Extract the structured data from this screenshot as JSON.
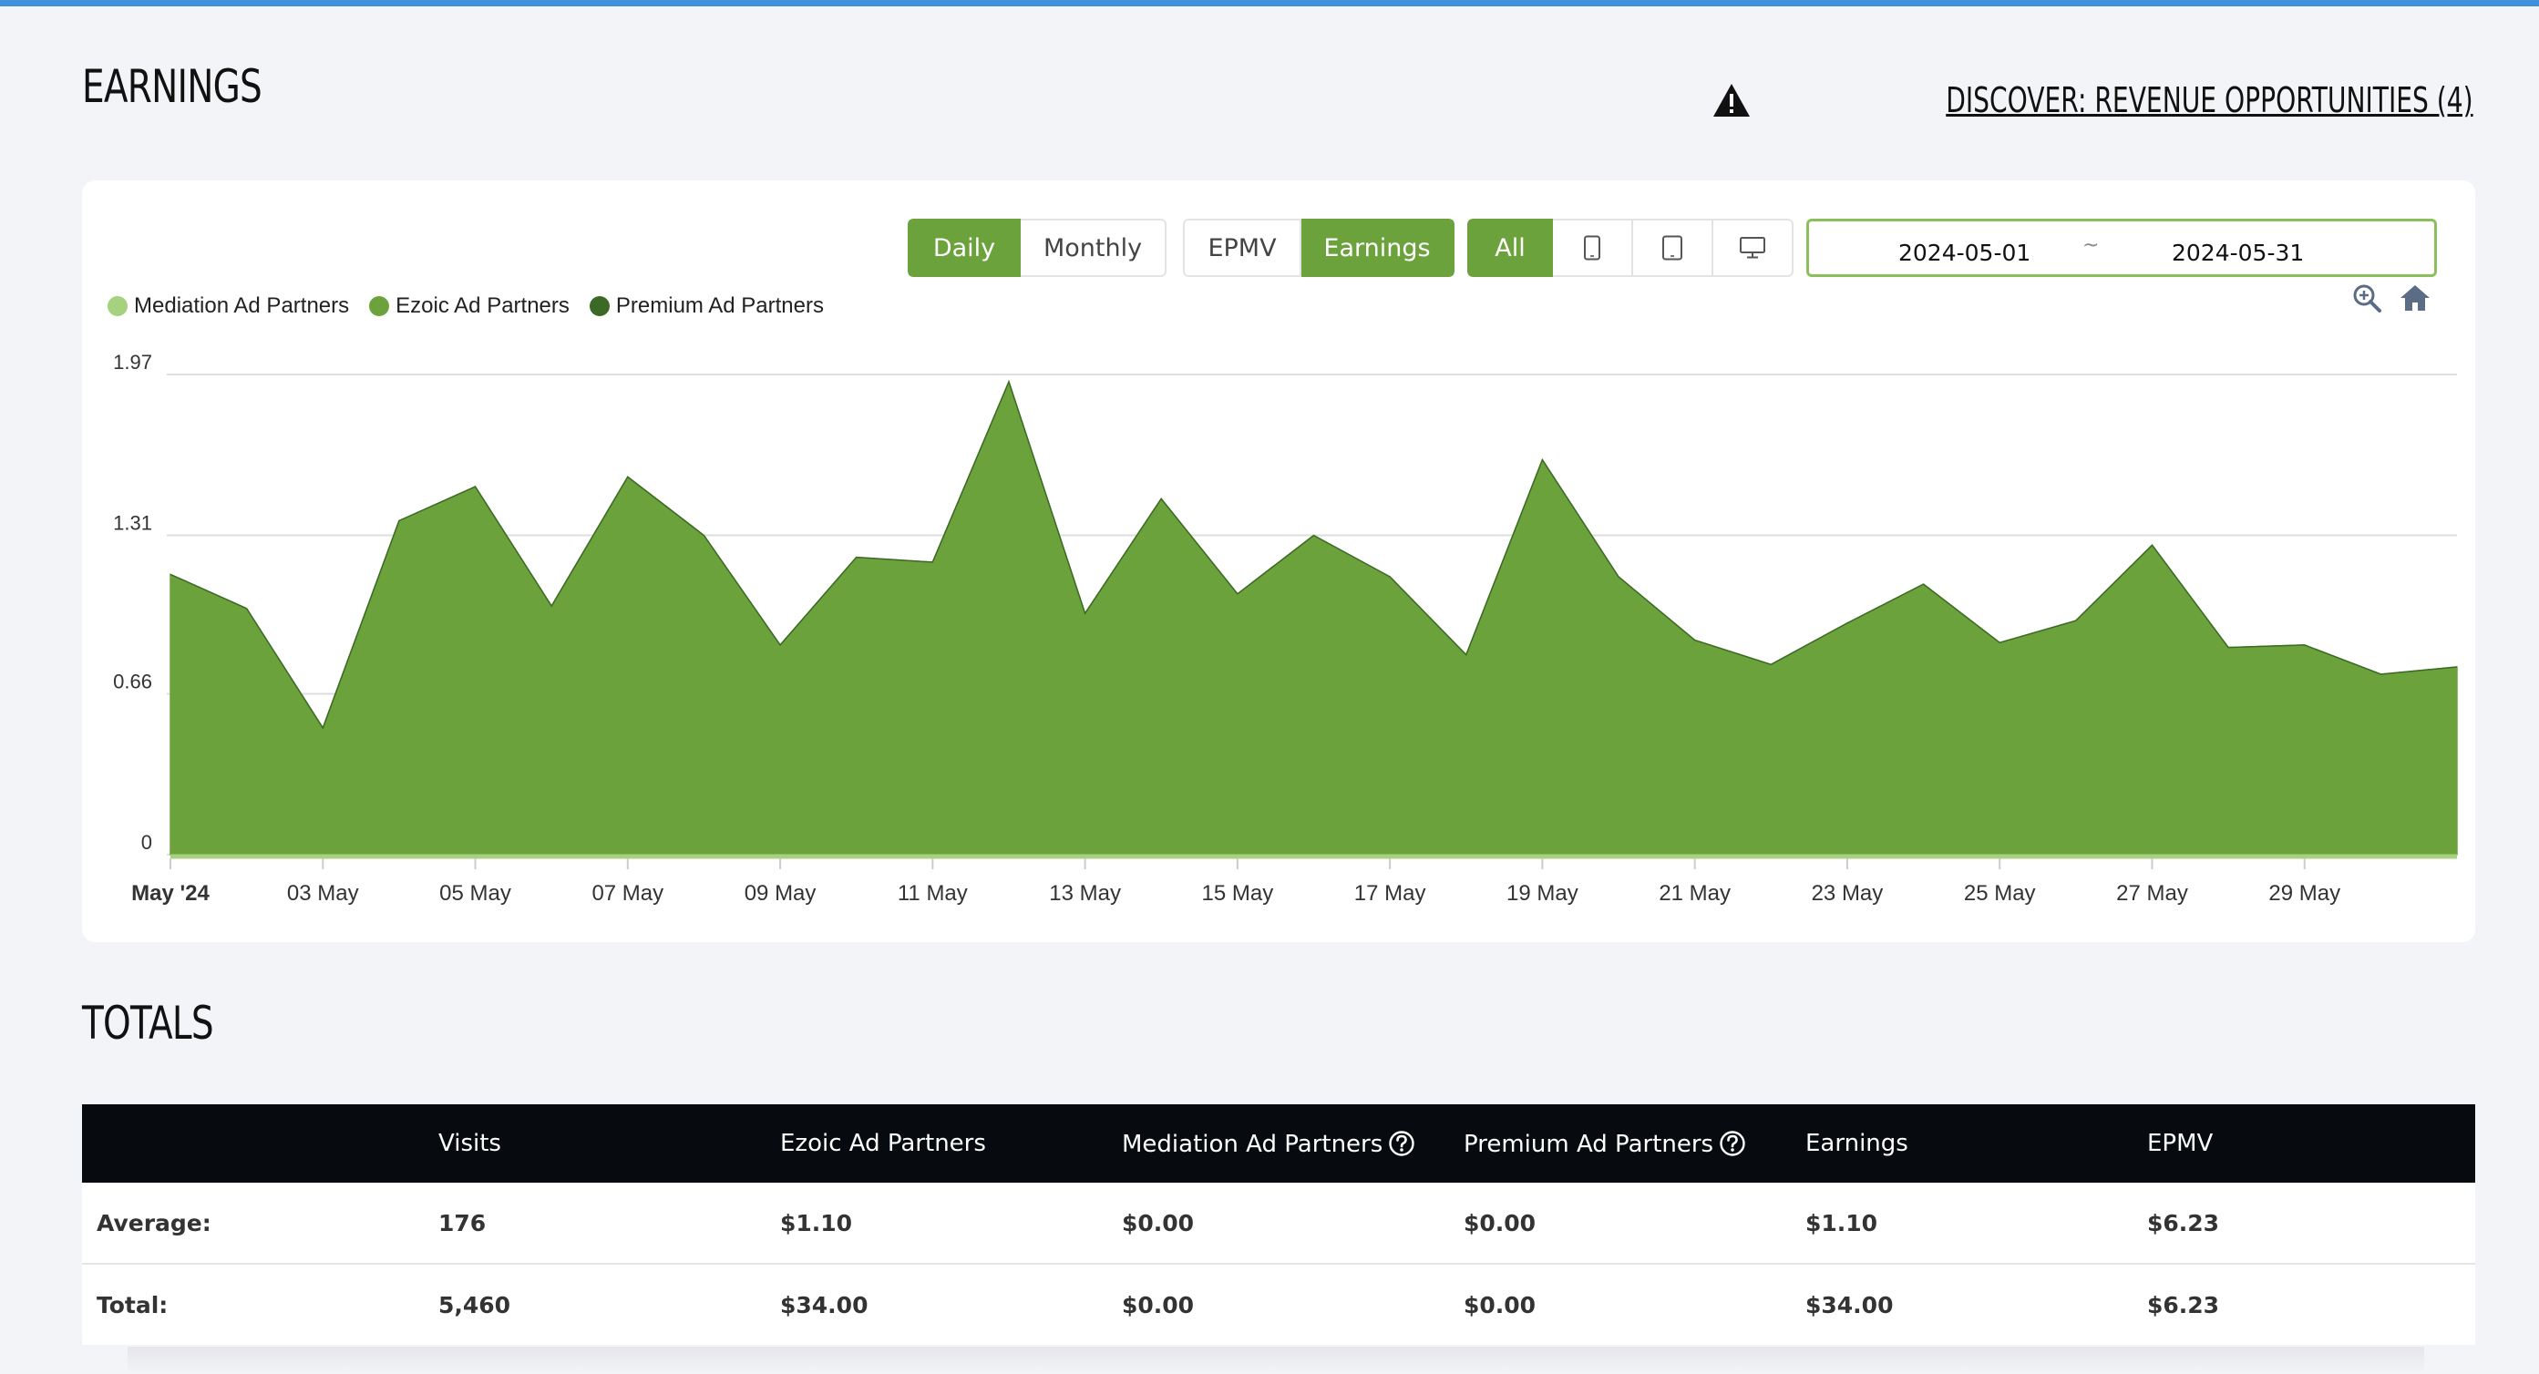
{
  "earnings": {
    "title": "EARNINGS",
    "discover_label": "DISCOVER: REVENUE OPPORTUNITIES (4)"
  },
  "controls": {
    "period": [
      {
        "label": "Daily",
        "active": true
      },
      {
        "label": "Monthly",
        "active": false
      }
    ],
    "metric": [
      {
        "label": "EPMV",
        "active": false
      },
      {
        "label": "Earnings",
        "active": true
      }
    ],
    "device": [
      {
        "label": "All",
        "icon": "",
        "active": true
      },
      {
        "label": "",
        "icon": "phone-icon",
        "active": false
      },
      {
        "label": "",
        "icon": "tablet-icon",
        "active": false
      },
      {
        "label": "",
        "icon": "desktop-icon",
        "active": false
      }
    ],
    "date_start": "2024-05-01",
    "date_sep": "~",
    "date_end": "2024-05-31"
  },
  "colors": {
    "accent": "#6ca23c",
    "mediation": "#a6d17f",
    "ezoic": "#6ca23c",
    "premium": "#3c6a26"
  },
  "chart_data": {
    "type": "area",
    "stacked": true,
    "x": [
      "2024-05-01",
      "2024-05-02",
      "2024-05-03",
      "2024-05-04",
      "2024-05-05",
      "2024-05-06",
      "2024-05-07",
      "2024-05-08",
      "2024-05-09",
      "2024-05-10",
      "2024-05-11",
      "2024-05-12",
      "2024-05-13",
      "2024-05-14",
      "2024-05-15",
      "2024-05-16",
      "2024-05-17",
      "2024-05-18",
      "2024-05-19",
      "2024-05-20",
      "2024-05-21",
      "2024-05-22",
      "2024-05-23",
      "2024-05-24",
      "2024-05-25",
      "2024-05-26",
      "2024-05-27",
      "2024-05-28",
      "2024-05-29",
      "2024-05-30",
      "2024-05-31"
    ],
    "x_tick_labels": [
      "May '24",
      "03 May",
      "05 May",
      "07 May",
      "09 May",
      "11 May",
      "13 May",
      "15 May",
      "17 May",
      "19 May",
      "21 May",
      "23 May",
      "25 May",
      "27 May",
      "29 May"
    ],
    "y_ticks": [
      "0",
      "0.66",
      "1.31",
      "1.97"
    ],
    "ylim": [
      0,
      1.97
    ],
    "grid": true,
    "legend_position": "top-left",
    "series": [
      {
        "name": "Mediation Ad Partners",
        "values": [
          0,
          0,
          0,
          0,
          0,
          0,
          0,
          0,
          0,
          0,
          0,
          0,
          0,
          0,
          0,
          0,
          0,
          0,
          0,
          0,
          0,
          0,
          0,
          0,
          0,
          0,
          0,
          0,
          0,
          0,
          0
        ]
      },
      {
        "name": "Ezoic Ad Partners",
        "values": [
          1.15,
          1.01,
          0.52,
          1.37,
          1.51,
          1.02,
          1.55,
          1.31,
          0.86,
          1.22,
          1.2,
          1.94,
          0.99,
          1.46,
          1.07,
          1.31,
          1.14,
          0.82,
          1.62,
          1.14,
          0.88,
          0.78,
          0.95,
          1.11,
          0.87,
          0.96,
          1.27,
          0.85,
          0.86,
          0.74,
          0.77
        ]
      },
      {
        "name": "Premium Ad Partners",
        "values": [
          0,
          0,
          0,
          0,
          0,
          0,
          0,
          0,
          0,
          0,
          0,
          0,
          0,
          0,
          0,
          0,
          0,
          0,
          0,
          0,
          0,
          0,
          0,
          0,
          0,
          0,
          0,
          0,
          0,
          0,
          0
        ]
      }
    ]
  },
  "totals": {
    "title": "TOTALS",
    "headers": [
      "",
      "Visits",
      "Ezoic Ad Partners",
      "Mediation Ad Partners",
      "Premium Ad Partners",
      "Earnings",
      "EPMV"
    ],
    "rows": [
      [
        "Average:",
        "176",
        "$1.10",
        "$0.00",
        "$0.00",
        "$1.10",
        "$6.23"
      ],
      [
        "Total:",
        "5,460",
        "$34.00",
        "$0.00",
        "$0.00",
        "$34.00",
        "$6.23"
      ]
    ]
  }
}
